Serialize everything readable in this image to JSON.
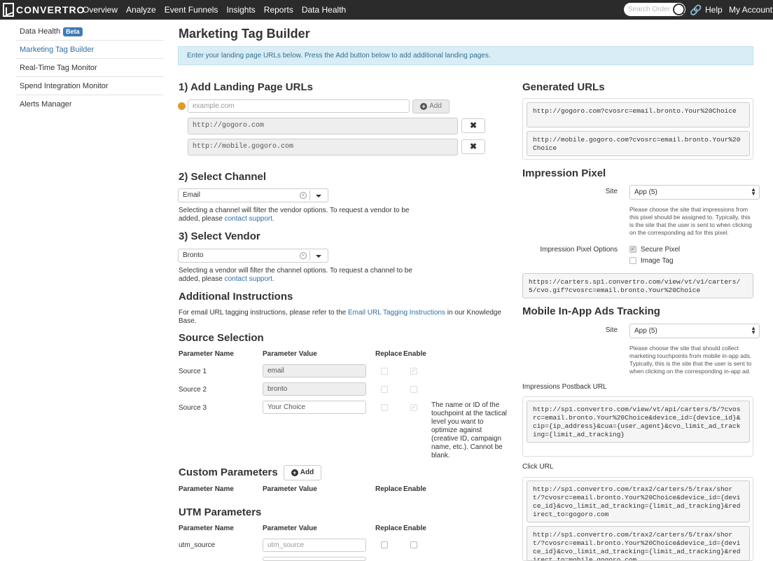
{
  "topbar": {
    "brand": "CONVERTRO",
    "nav": [
      "Overview",
      "Analyze",
      "Event Funnels",
      "Insights",
      "Reports",
      "Data Health"
    ],
    "search_placeholder": "Search Orders",
    "help": "Help",
    "account": "My Account"
  },
  "sidebar": {
    "items": [
      {
        "label": "Data Health",
        "badge": "Beta"
      },
      {
        "label": "Marketing Tag Builder"
      },
      {
        "label": "Real-Time Tag Monitor"
      },
      {
        "label": "Spend Integration Monitor"
      },
      {
        "label": "Alerts Manager"
      }
    ]
  },
  "main": {
    "title": "Marketing Tag Builder",
    "info": "Enter your landing page URLs below. Press the Add button below to add additional landing pages.",
    "urls": {
      "heading": "1) Add Landing Page URLs",
      "placeholder": "example.com",
      "add_label": "Add",
      "entries": [
        "http://gogoro.com",
        "http://mobile.gogoro.com"
      ]
    },
    "channel": {
      "heading": "2) Select Channel",
      "value": "Email",
      "help_pre": "Selecting a channel will filter the vendor options. To request a vendor to be added, please",
      "help_link": "contact support."
    },
    "vendor": {
      "heading": "3) Select Vendor",
      "value": "Bronto",
      "help_pre": "Selecting a vendor will filter the channel options. To request a channel to be added, please",
      "help_link": "contact support."
    },
    "instructions": {
      "heading": "Additional Instructions",
      "pre": "For email URL tagging instructions, please refer to the",
      "link": "Email URL Tagging Instructions",
      "post": "in our Knowledge Base."
    },
    "source": {
      "heading": "Source Selection",
      "columns": [
        "Parameter Name",
        "Parameter Value",
        "Replace",
        "Enable"
      ],
      "rows": [
        {
          "name": "Source 1",
          "value": "email",
          "replace": false,
          "enable": true
        },
        {
          "name": "Source 2",
          "value": "bronto",
          "replace": false,
          "enable": false
        },
        {
          "name": "Source 3",
          "value": "Your Choice",
          "replace": false,
          "enable": true
        }
      ],
      "note": "The name or ID of the touchpoint at the tactical level you want to optimize against (creative ID, campaign name, etc.). Cannot be blank."
    },
    "custom": {
      "heading": "Custom Parameters",
      "add_label": "Add",
      "columns": [
        "Parameter Name",
        "Parameter Value",
        "Replace",
        "Enable"
      ]
    },
    "utm": {
      "heading": "UTM Parameters",
      "columns": [
        "Parameter Name",
        "Parameter Value",
        "Replace",
        "Enable"
      ],
      "rows": [
        {
          "name": "utm_source",
          "placeholder": "utm_source"
        }
      ]
    }
  },
  "right": {
    "generated": {
      "heading": "Generated URLs",
      "urls": [
        "http://gogoro.com?cvosrc=email.bronto.Your%20Choice",
        "http://mobile.gogoro.com?cvosrc=email.bronto.Your%20Choice"
      ]
    },
    "impression": {
      "heading": "Impression Pixel",
      "site_label": "Site",
      "site_value": "App (5)",
      "site_help": "Please choose the site that impressions from this pixel should be assigned to. Typically, this is the site that the user is sent to when clicking on the corresponding ad for this pixel.",
      "options_label": "Impression Pixel Options",
      "secure_label": "Secure Pixel",
      "image_label": "Image Tag",
      "pixel_url": "https://carters.sp1.convertro.com/view/vt/v1/carters/5/cvo.gif?cvosrc=email.bronto.Your%20Choice"
    },
    "mobile": {
      "heading": "Mobile In-App Ads Tracking",
      "site_label": "Site",
      "site_value": "App (5)",
      "site_help": "Please choose the site that should collect marketing touchpoints from mobile in-app ads. Typically, this is the site that the user is sent to when clicking on the corresponding in-app ad.",
      "postback_label": "Impressions Postback URL",
      "postback_url": "http://sp1.convertro.com/view/vt/api/carters/5/?cvosrc=email.bronto.Your%20Choice&device_id={device_id}&cip={ip_address}&cua={user_agent}&cvo_limit_ad_tracking={limit_ad_tracking}",
      "click_label": "Click URL",
      "click_urls": [
        "http://sp1.convertro.com/trax2/carters/5/trax/short/?cvosrc=email.bronto.Your%20Choice&device_id={device_id}&cvo_limit_ad_tracking={limit_ad_tracking}&redirect_to=gogoro.com",
        "http://sp1.convertro.com/trax2/carters/5/trax/short/?cvosrc=email.bronto.Your%20Choice&device_id={device_id}&cvo_limit_ad_tracking={limit_ad_tracking}&redirect_to=mobile.gogoro.com"
      ]
    }
  },
  "colors": {
    "topbar": "#2b2b2b",
    "link": "#2f6ea8",
    "info_bg": "#d9edf7",
    "badge": "#3e7bb5",
    "url_dot": "#e09a2c"
  }
}
